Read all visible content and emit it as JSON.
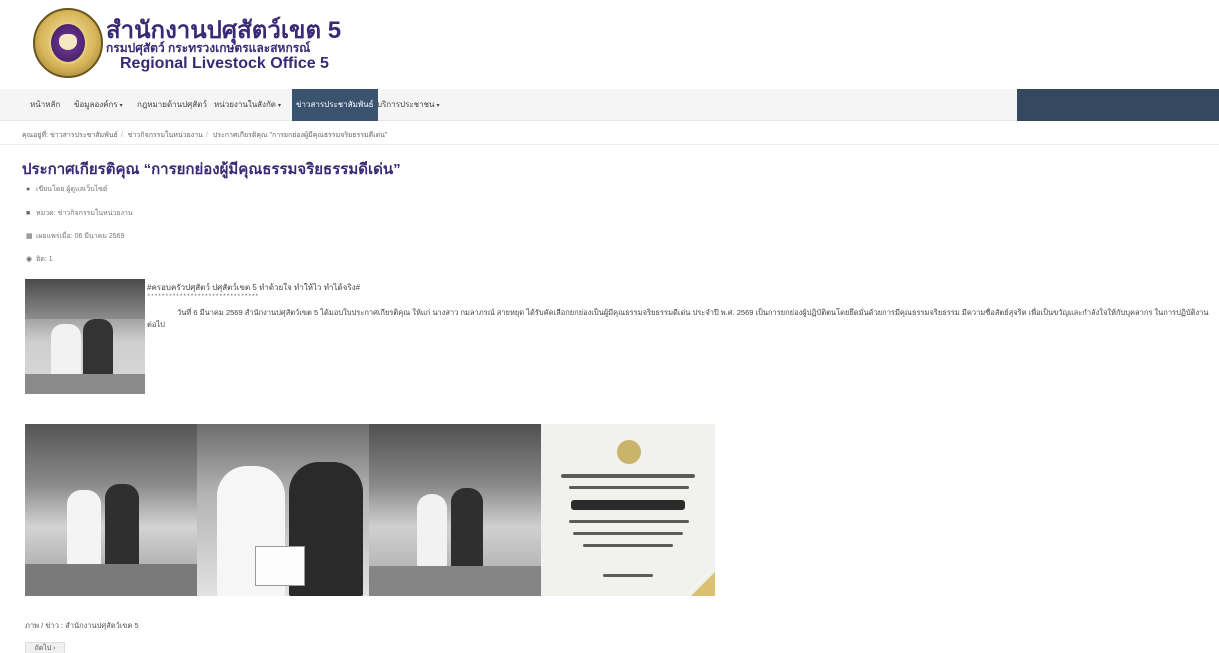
{
  "header": {
    "title_th": "สำนักงานปศุสัตว์เขต 5",
    "subtitle_th": "กรมปศุสัตว์ กระทรวงเกษตรและสหกรณ์",
    "title_en": "Regional Livestock Office 5"
  },
  "nav": {
    "items": [
      {
        "label": "หน้าหลัก",
        "caret": ""
      },
      {
        "label": "ข้อมูลองค์กร",
        "caret": "▾"
      },
      {
        "label": "กฎหมายด้านปศุสัตว์",
        "caret": ""
      },
      {
        "label": "หน่วยงานในสังกัด",
        "caret": "▾"
      },
      {
        "label": "ข่าวสารประชาสัมพันธ์",
        "caret": ""
      },
      {
        "label": "บริการประชาชน",
        "caret": "▾"
      }
    ],
    "active_index": 4
  },
  "breadcrumb": {
    "prefix": "คุณอยู่ที่:",
    "items": [
      "ข่าวสารประชาสัมพันธ์",
      "ข่าวกิจกรรมในหน่วยงาน",
      "ประกาศเกียรติคุณ \"การยกย่องผู้มีคุณธรรมจริยธรรมดีเด่น\""
    ]
  },
  "article": {
    "title": "ประกาศเกียรติคุณ “การยกย่องผู้มีคุณธรรมจริยธรรมดีเด่น”",
    "author": "เขียนโดย ผู้ดูแลเว็บไซต์",
    "category": "หมวด: ข่าวกิจกรรมในหน่วยงาน",
    "published": "เผยแพร่เมื่อ: 06 มีนาคม 2569",
    "hits": "ฮิต: 1",
    "hashtag": "#ครอบครัวปศุสัตว์ ปศุสัตว์เขต 5 ทำด้วยใจ ทำให้ไว ทำได้จริง#",
    "stars": "*******************************",
    "body": "วันที่ 6 มีนาคม 2569 สำนักงานปศุสัตว์เขต 5 ได้มอบใบประกาศเกียรติคุณ ให้แก่ นางสาว กมลาภรณ์ สายหยุด ได้รับคัดเลือกยกย่องเป็นผู้มีคุณธรรมจริยธรรมดีเด่น ประจำปี พ.ศ. 2569 เป็นการยกย่องผู้ปฏิบัติตนโดยยึดมั่นด้วยการมีคุณธรรมจริยธรรม มีความซื่อสัตย์สุจริต เพื่อเป็นขวัญและกำลังใจให้กับบุคลากร ในการปฏิบัติงานต่อไป",
    "credit": "ภาพ / ข่าว :  สำนักงานปศุสัตว์เขต 5",
    "next_label": "ถัดไป ›"
  },
  "icons": {
    "author": "user-icon",
    "category": "folder-icon",
    "published": "calendar-icon",
    "hits": "eye-icon"
  },
  "colors": {
    "brand": "#3a2a75",
    "nav_active": "#3a5470",
    "nav_dark": "#34495e"
  }
}
